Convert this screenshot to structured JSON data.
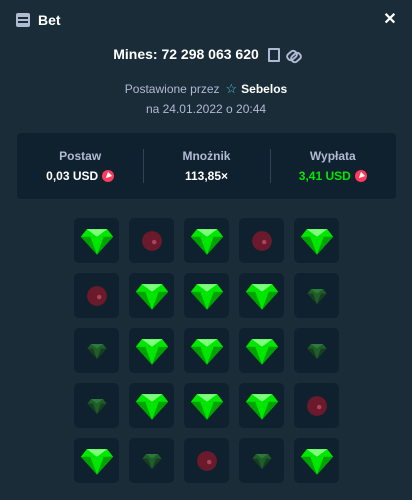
{
  "header": {
    "title": "Bet",
    "icon": "bet-slip-icon",
    "close_icon": "close-icon"
  },
  "bet": {
    "title": "Mines: 72 298 063 620",
    "placed_by_label": "Postawione przez",
    "user": "Sebelos",
    "date": "na 24.01.2022 o 20:44"
  },
  "stats": {
    "stake_label": "Postaw",
    "stake_value": "0,03 USD",
    "multiplier_label": "Mnożnik",
    "multiplier_value": "113,85×",
    "payout_label": "Wypłata",
    "payout_value": "3,41 USD"
  },
  "colors": {
    "background": "#1a2c38",
    "panel": "#0f212e",
    "gem_bright": "#00e701",
    "gem_dim": "#1f5e2a",
    "mine_dim": "#6b1a2c",
    "currency_coin": "#ff3b5c"
  },
  "grid": [
    [
      "gem",
      "mine-dim",
      "gem",
      "mine-dim",
      "gem"
    ],
    [
      "mine-dim",
      "gem",
      "gem",
      "gem",
      "gem-dim"
    ],
    [
      "gem-dim",
      "gem",
      "gem",
      "gem",
      "gem-dim"
    ],
    [
      "gem-dim",
      "gem",
      "gem",
      "gem",
      "mine-dim"
    ],
    [
      "gem",
      "gem-dim",
      "mine-dim",
      "gem-dim",
      "gem"
    ]
  ]
}
